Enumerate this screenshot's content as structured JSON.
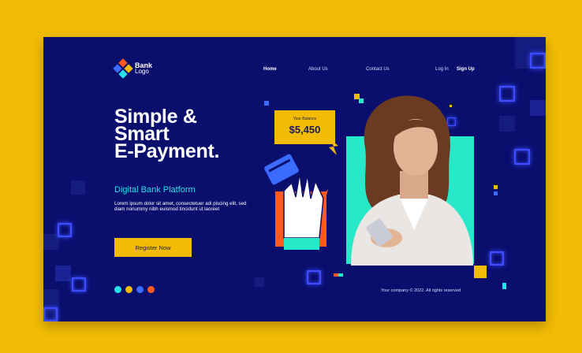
{
  "logo": {
    "line1": "Bank",
    "line2": "Logo"
  },
  "nav": [
    {
      "label": "Home",
      "active": true
    },
    {
      "label": "About Us",
      "active": false
    },
    {
      "label": "Contact Us",
      "active": false
    },
    {
      "label": "Log In",
      "active": false
    },
    {
      "label": "Sign Up",
      "active": true
    }
  ],
  "hero": {
    "headline": [
      "Simple &",
      "Smart",
      "E-Payment."
    ],
    "subhead": "Digital Bank Platform",
    "description": "Lorem ipsum dolor sit amet, consectetuer adi piscing elit, sed diam nonummy nibh euismod tincidunt ut laoreet",
    "cta": "Register Now"
  },
  "balance": {
    "label": "Your Balance",
    "amount": "$5,450"
  },
  "social": [
    {
      "icon": "instagram-icon",
      "color": "#27e0e8"
    },
    {
      "icon": "twitter-icon",
      "color": "#f2bb05"
    },
    {
      "icon": "facebook-icon",
      "color": "#3b6cff"
    },
    {
      "icon": "dribbble-icon",
      "color": "#ff5a1f"
    }
  ],
  "footer": {
    "copyright": "Your company © 2022. All rights reserved"
  },
  "colors": {
    "background": "#0a0f6e",
    "accent": "#f2bb05",
    "teal": "#27e8c8",
    "orange": "#ff5a1f",
    "cyan": "#27e0e8"
  }
}
